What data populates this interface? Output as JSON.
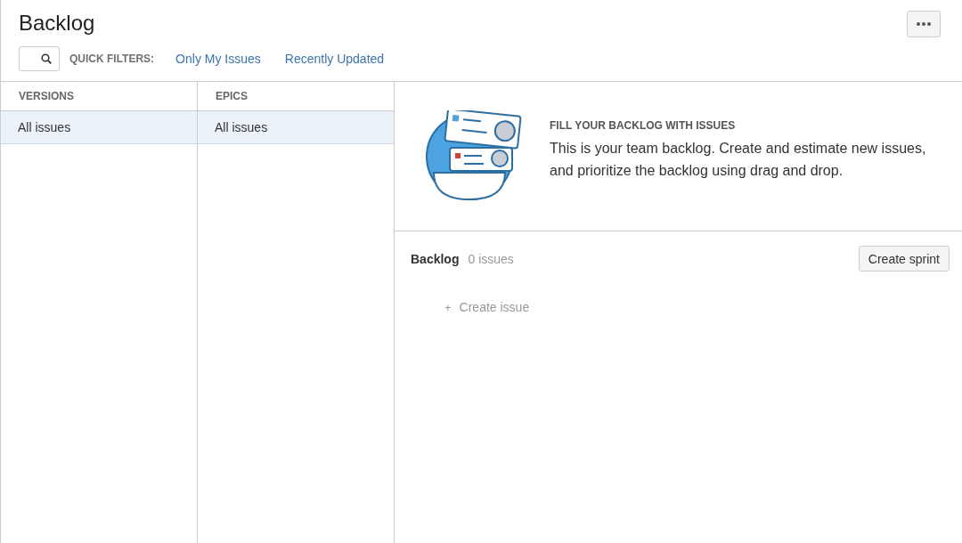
{
  "page": {
    "title": "Backlog"
  },
  "quick_filters": {
    "label": "QUICK FILTERS:",
    "filters": [
      {
        "label": "Only My Issues",
        "selected": false
      },
      {
        "label": "Recently Updated",
        "selected": false
      }
    ]
  },
  "versions": {
    "heading": "VERSIONS",
    "items": [
      {
        "label": "All issues",
        "selected": true
      }
    ]
  },
  "epics": {
    "heading": "EPICS",
    "items": [
      {
        "label": "All issues",
        "selected": true
      }
    ]
  },
  "intro": {
    "title": "FILL YOUR BACKLOG WITH ISSUES",
    "text": "This is your team backlog. Create and estimate new issues, and prioritize the backlog using drag and drop."
  },
  "backlog": {
    "title": "Backlog",
    "count": "0 issues",
    "button": "Create sprint",
    "create_issue": {
      "icon": "+",
      "label": "Create issue"
    }
  }
}
